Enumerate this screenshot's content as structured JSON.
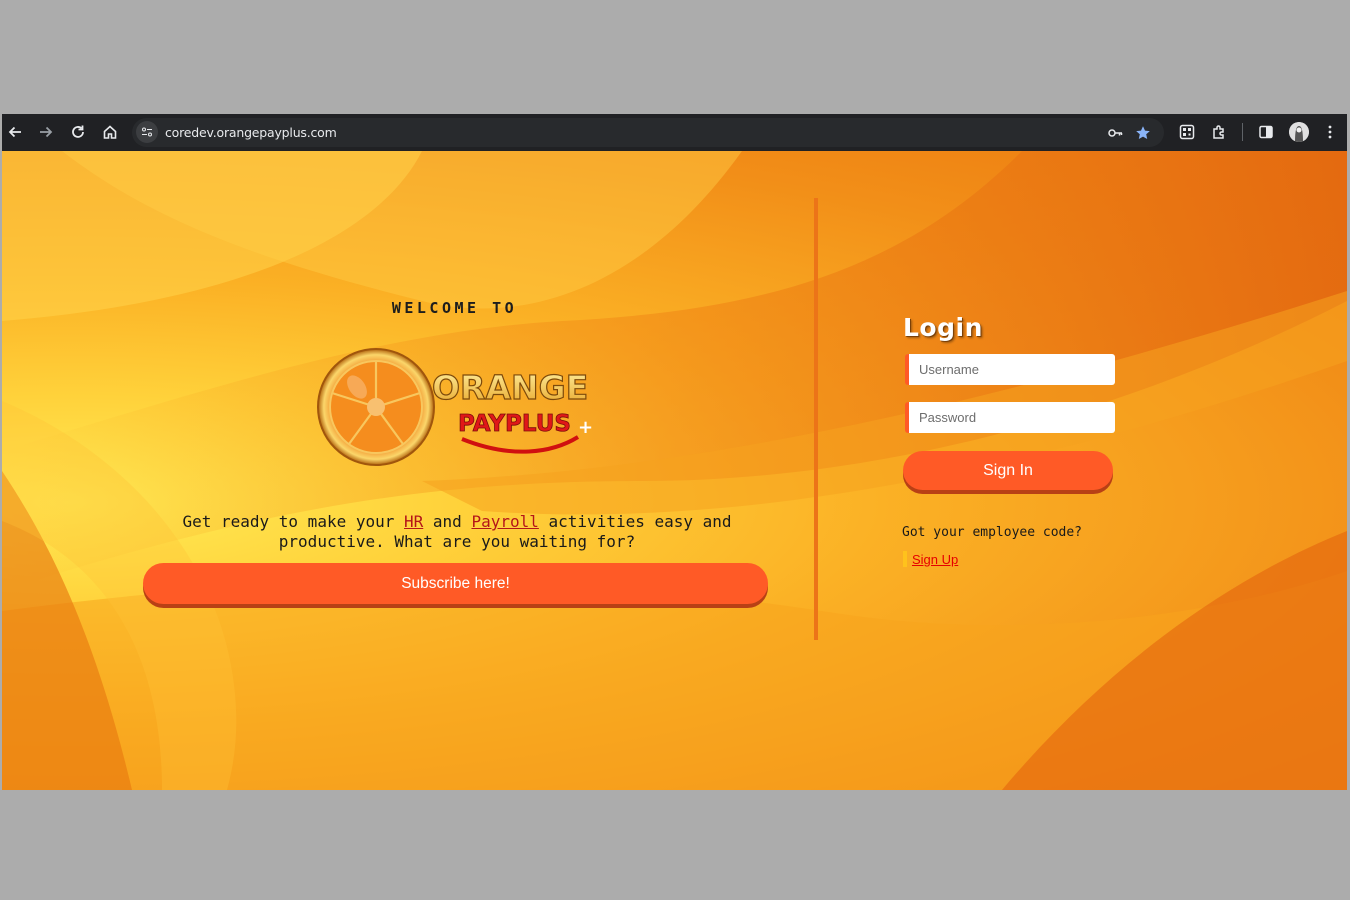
{
  "browser": {
    "url": "coredev.orangepayplus.com",
    "icons": [
      "back-icon",
      "forward-icon",
      "reload-icon",
      "home-icon",
      "site-info-icon",
      "password-key-icon",
      "bookmark-star-icon",
      "qr-code-icon",
      "extensions-icon",
      "side-panel-icon",
      "profile-avatar",
      "menu-kebab-icon"
    ],
    "accent": "#8ab4f8"
  },
  "hero": {
    "welcome": "WELCOME TO",
    "logo_line1": "ORANGE",
    "logo_line2": "PAYPLUS",
    "logo_plus": "+",
    "tagline_part1": "Get ready to make your ",
    "tagline_hr": "HR",
    "tagline_part2": " and ",
    "tagline_payroll": "Payroll",
    "tagline_part3": " activities easy and productive. What are you waiting for?",
    "subscribe_label": "Subscribe here!"
  },
  "login": {
    "title": "Login",
    "username_placeholder": "Username",
    "password_placeholder": "Password",
    "signin_label": "Sign In",
    "code_question": "Got your employee code?",
    "signup_label": "Sign Up"
  },
  "colors": {
    "button": "#ff5a26",
    "link": "#e60000",
    "background": "#f39a1a"
  }
}
